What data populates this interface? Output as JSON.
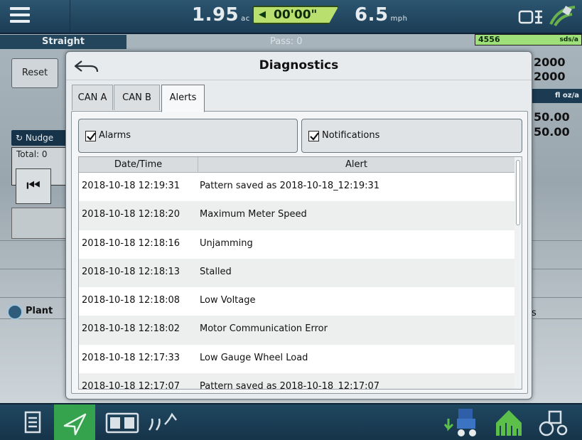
{
  "top_bar": {
    "area_value": "1.95",
    "area_unit": "ac",
    "timer": "00'00\"",
    "speed_value": "6.5",
    "speed_unit": "mph"
  },
  "background": {
    "guidance_mode": "Straight",
    "pass": "Pass: 0",
    "reset_label": "Reset",
    "nudge_label": "Nudge",
    "total_label": "Total: 0",
    "planting_label": "Plant",
    "seed_count": "4556",
    "seed_unit": "sds/a",
    "rate_values": [
      "2000",
      "2000"
    ],
    "flow_unit": "fl oz/a",
    "flow_values": [
      "50.00",
      "50.00"
    ],
    "partial_label": "s"
  },
  "dialog": {
    "title": "Diagnostics",
    "tabs": [
      {
        "label": "CAN A",
        "active": false
      },
      {
        "label": "CAN B",
        "active": false
      },
      {
        "label": "Alerts",
        "active": true
      }
    ],
    "filters": {
      "alarms": {
        "label": "Alarms",
        "checked": true
      },
      "notifications": {
        "label": "Notifications",
        "checked": true
      }
    },
    "table": {
      "columns": [
        "Date/Time",
        "Alert"
      ],
      "rows": [
        {
          "datetime": "2018-10-18 12:19:31",
          "alert": "Pattern saved as 2018-10-18_12:19:31"
        },
        {
          "datetime": "2018-10-18 12:18:20",
          "alert": "Maximum Meter Speed"
        },
        {
          "datetime": "2018-10-18 12:18:16",
          "alert": "Unjamming"
        },
        {
          "datetime": "2018-10-18 12:18:13",
          "alert": "Stalled"
        },
        {
          "datetime": "2018-10-18 12:18:08",
          "alert": "Low Voltage"
        },
        {
          "datetime": "2018-10-18 12:18:02",
          "alert": "Motor Communication Error"
        },
        {
          "datetime": "2018-10-18 12:17:33",
          "alert": "Low Gauge Wheel Load"
        },
        {
          "datetime": "2018-10-18 12:17:07",
          "alert": "Pattern saved as 2018-10-18_12:17:07"
        }
      ]
    }
  },
  "colors": {
    "top_bar": "#1f4760",
    "timer_fill": "#b9e06f",
    "active_nav": "#35a24d",
    "row_alt": "#edeeee"
  },
  "icons": {
    "menu": "hamburger-icon",
    "timer_arrow": "arrow-left-icon",
    "gps": "satellite-icon",
    "back": "back-arrow-icon",
    "notes": "document-icon",
    "guidance": "navigation-arrow-icon",
    "split": "split-screen-icon",
    "planting": "seed-rows-icon",
    "seed": "planter-icon",
    "yield": "yield-arrow-icon",
    "vehicle": "tractor-icon"
  }
}
